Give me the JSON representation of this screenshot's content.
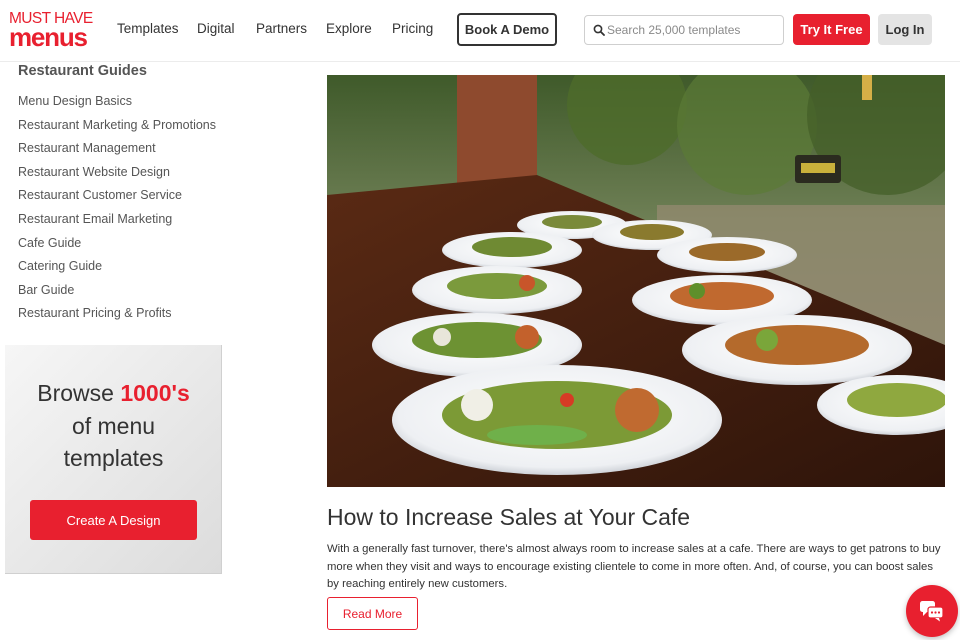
{
  "brand": {
    "logo_top": "MUST HAVE",
    "logo_bottom": "menus",
    "color": "#e8202f"
  },
  "header": {
    "nav": [
      "Templates",
      "Digital",
      "Partners",
      "Explore",
      "Pricing"
    ],
    "book_demo_label": "Book A Demo",
    "search_placeholder": "Search 25,000 templates",
    "search_icon": "search-icon",
    "try_free_label": "Try It Free",
    "login_label": "Log In"
  },
  "sidebar": {
    "title": "Restaurant Guides",
    "items": [
      "Menu Design Basics",
      "Restaurant Marketing & Promotions",
      "Restaurant Management",
      "Restaurant Website Design",
      "Restaurant Customer Service",
      "Restaurant Email Marketing",
      "Cafe Guide",
      "Catering Guide",
      "Bar Guide",
      "Restaurant Pricing & Profits"
    ]
  },
  "promo": {
    "browse": "Browse",
    "highlight": "1000's",
    "line2": "of menu",
    "line3": "templates",
    "cta_label": "Create A Design"
  },
  "article": {
    "title": "How to Increase Sales at Your Cafe",
    "body": "With a generally fast turnover, there's almost always room to increase sales at a cafe. There are ways to get patrons to buy more when they visit and ways to encourage existing clientele to come in more often. And, of course, you can boost sales by reaching entirely new customers.",
    "read_more_label": "Read More"
  },
  "chat": {
    "icon": "chat-bubbles-icon"
  }
}
